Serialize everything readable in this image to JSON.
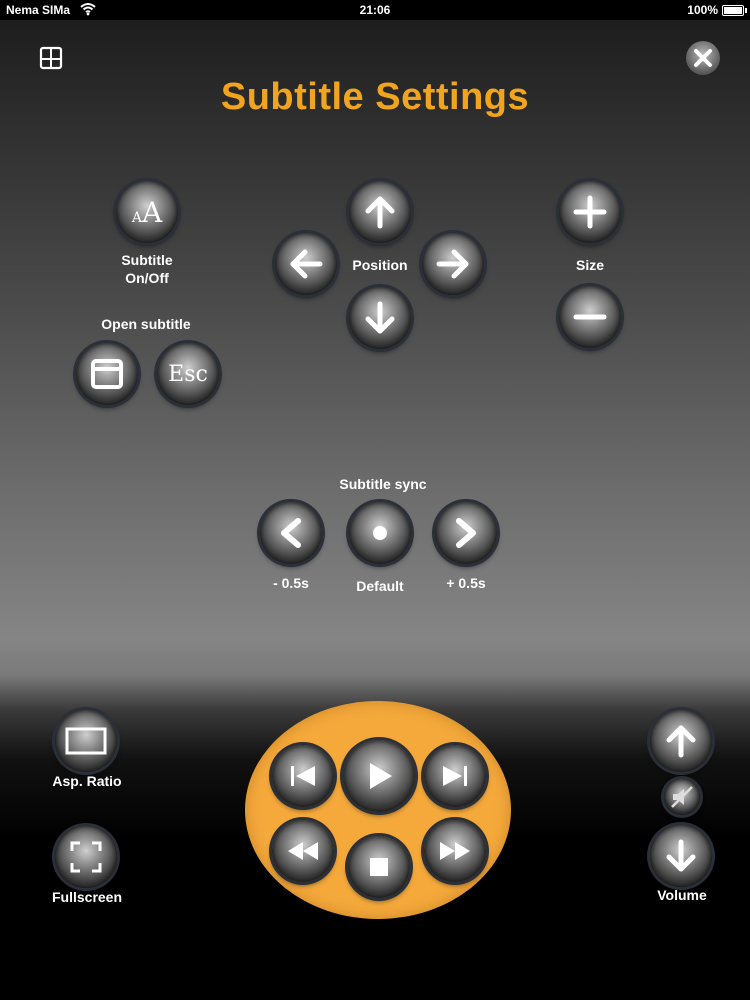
{
  "status_bar": {
    "carrier": "Nema SIMa",
    "time": "21:06",
    "battery": "100%"
  },
  "title": "Subtitle Settings",
  "subtitle_toggle": {
    "glyph_small": "A",
    "glyph_large": "A",
    "label": "Subtitle\nOn/Off"
  },
  "position": {
    "label": "Position"
  },
  "size": {
    "label": "Size"
  },
  "open_subtitle": {
    "label": "Open subtitle",
    "esc_glyph": "Esc"
  },
  "sync": {
    "label": "Subtitle sync",
    "minus_label": "- 0.5s",
    "default_label": "Default",
    "plus_label": "+ 0.5s"
  },
  "bottom": {
    "aspect_label": "Asp. Ratio",
    "fullscreen_label": "Fullscreen",
    "volume_label": "Volume"
  },
  "colors": {
    "accent": "#f1a51e",
    "remote_pad": "#f5a93b"
  },
  "icons": {
    "top_left": "split-screen-icon",
    "top_right": "close-icon",
    "mute": "mute-speaker-icon"
  }
}
